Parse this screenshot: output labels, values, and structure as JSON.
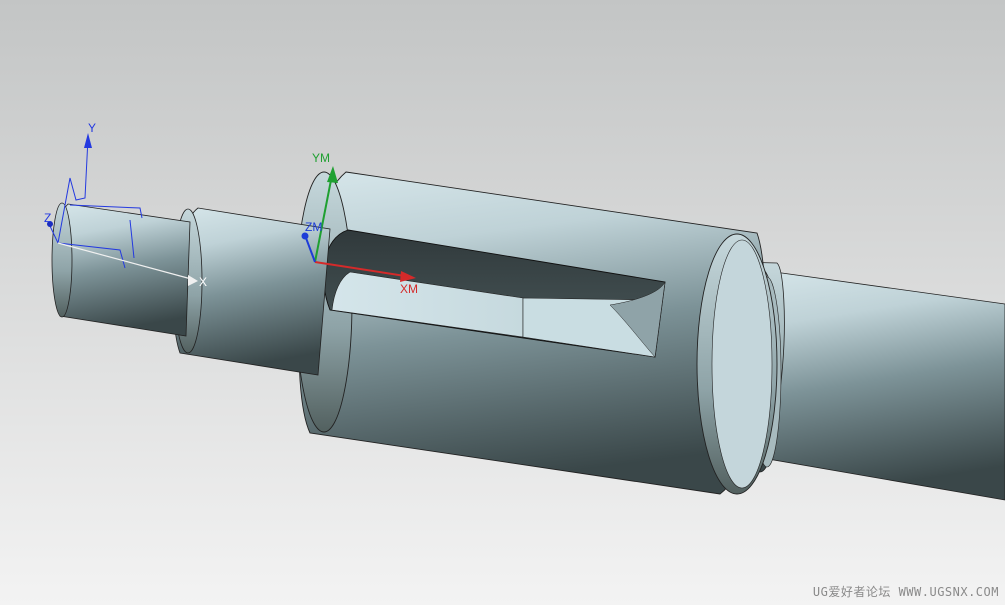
{
  "view": {
    "background_top": "#c5c7c7",
    "background_bottom": "#f2f2f2"
  },
  "colors": {
    "metal_light": "#d2e2e7",
    "metal_mid": "#7e9499",
    "metal_dark": "#39474a",
    "edge": "#1a1a1a",
    "axis_x": "#d42a2a",
    "axis_y": "#1fa031",
    "axis_z": "#1d3cd8",
    "wcs_blue": "#2339e0"
  },
  "wcs": {
    "x_label": "X",
    "y_label": "Y",
    "z_label": "Z"
  },
  "mcs": {
    "x_label": "XM",
    "y_label": "YM",
    "z_label": "ZM"
  },
  "watermark": {
    "text": "UG爱好者论坛 WWW.UGSNX.COM"
  }
}
